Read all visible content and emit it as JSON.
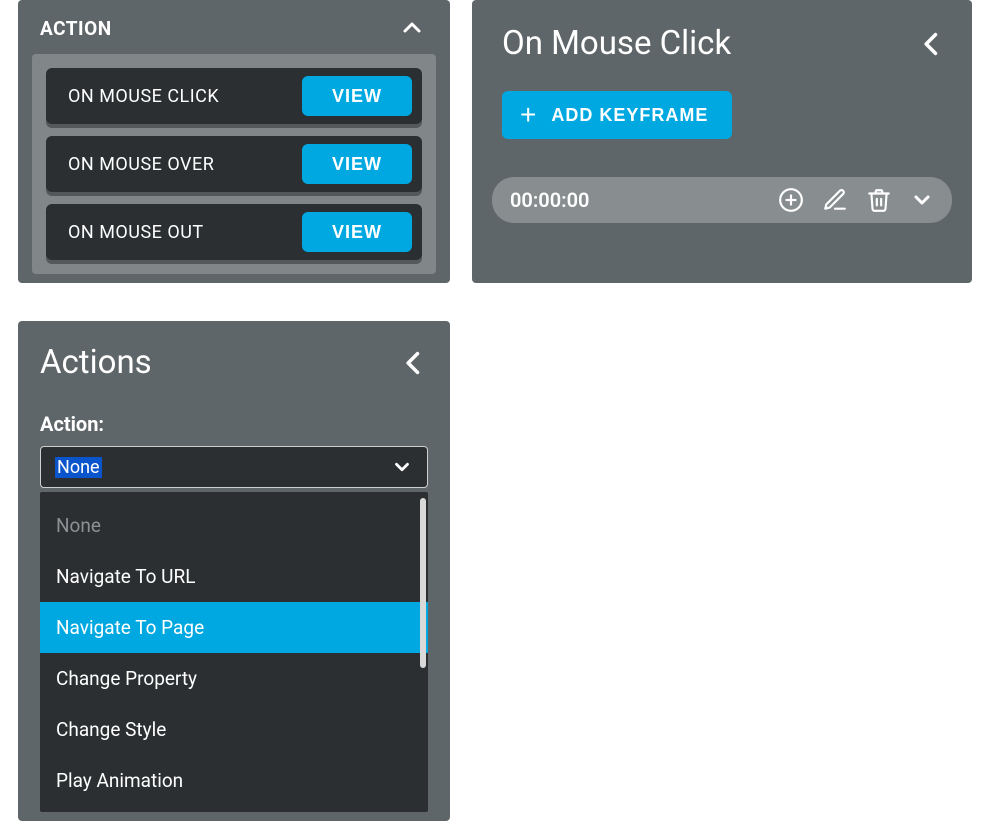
{
  "panel_action": {
    "title": "ACTION",
    "rows": [
      {
        "label": "ON MOUSE CLICK",
        "button": "VIEW"
      },
      {
        "label": "ON MOUSE OVER",
        "button": "VIEW"
      },
      {
        "label": "ON MOUSE OUT",
        "button": "VIEW"
      }
    ]
  },
  "panel_keyframe": {
    "title": "On Mouse Click",
    "add_button": "ADD KEYFRAME",
    "time": "00:00:00"
  },
  "panel_actions_select": {
    "title": "Actions",
    "label": "Action:",
    "selected": "None",
    "options": [
      {
        "text": "None",
        "disabled": true
      },
      {
        "text": "Navigate To URL",
        "disabled": false
      },
      {
        "text": "Navigate To Page",
        "disabled": false,
        "highlighted": true
      },
      {
        "text": "Change Property",
        "disabled": false
      },
      {
        "text": "Change Style",
        "disabled": false
      },
      {
        "text": "Play Animation",
        "disabled": false
      }
    ]
  }
}
